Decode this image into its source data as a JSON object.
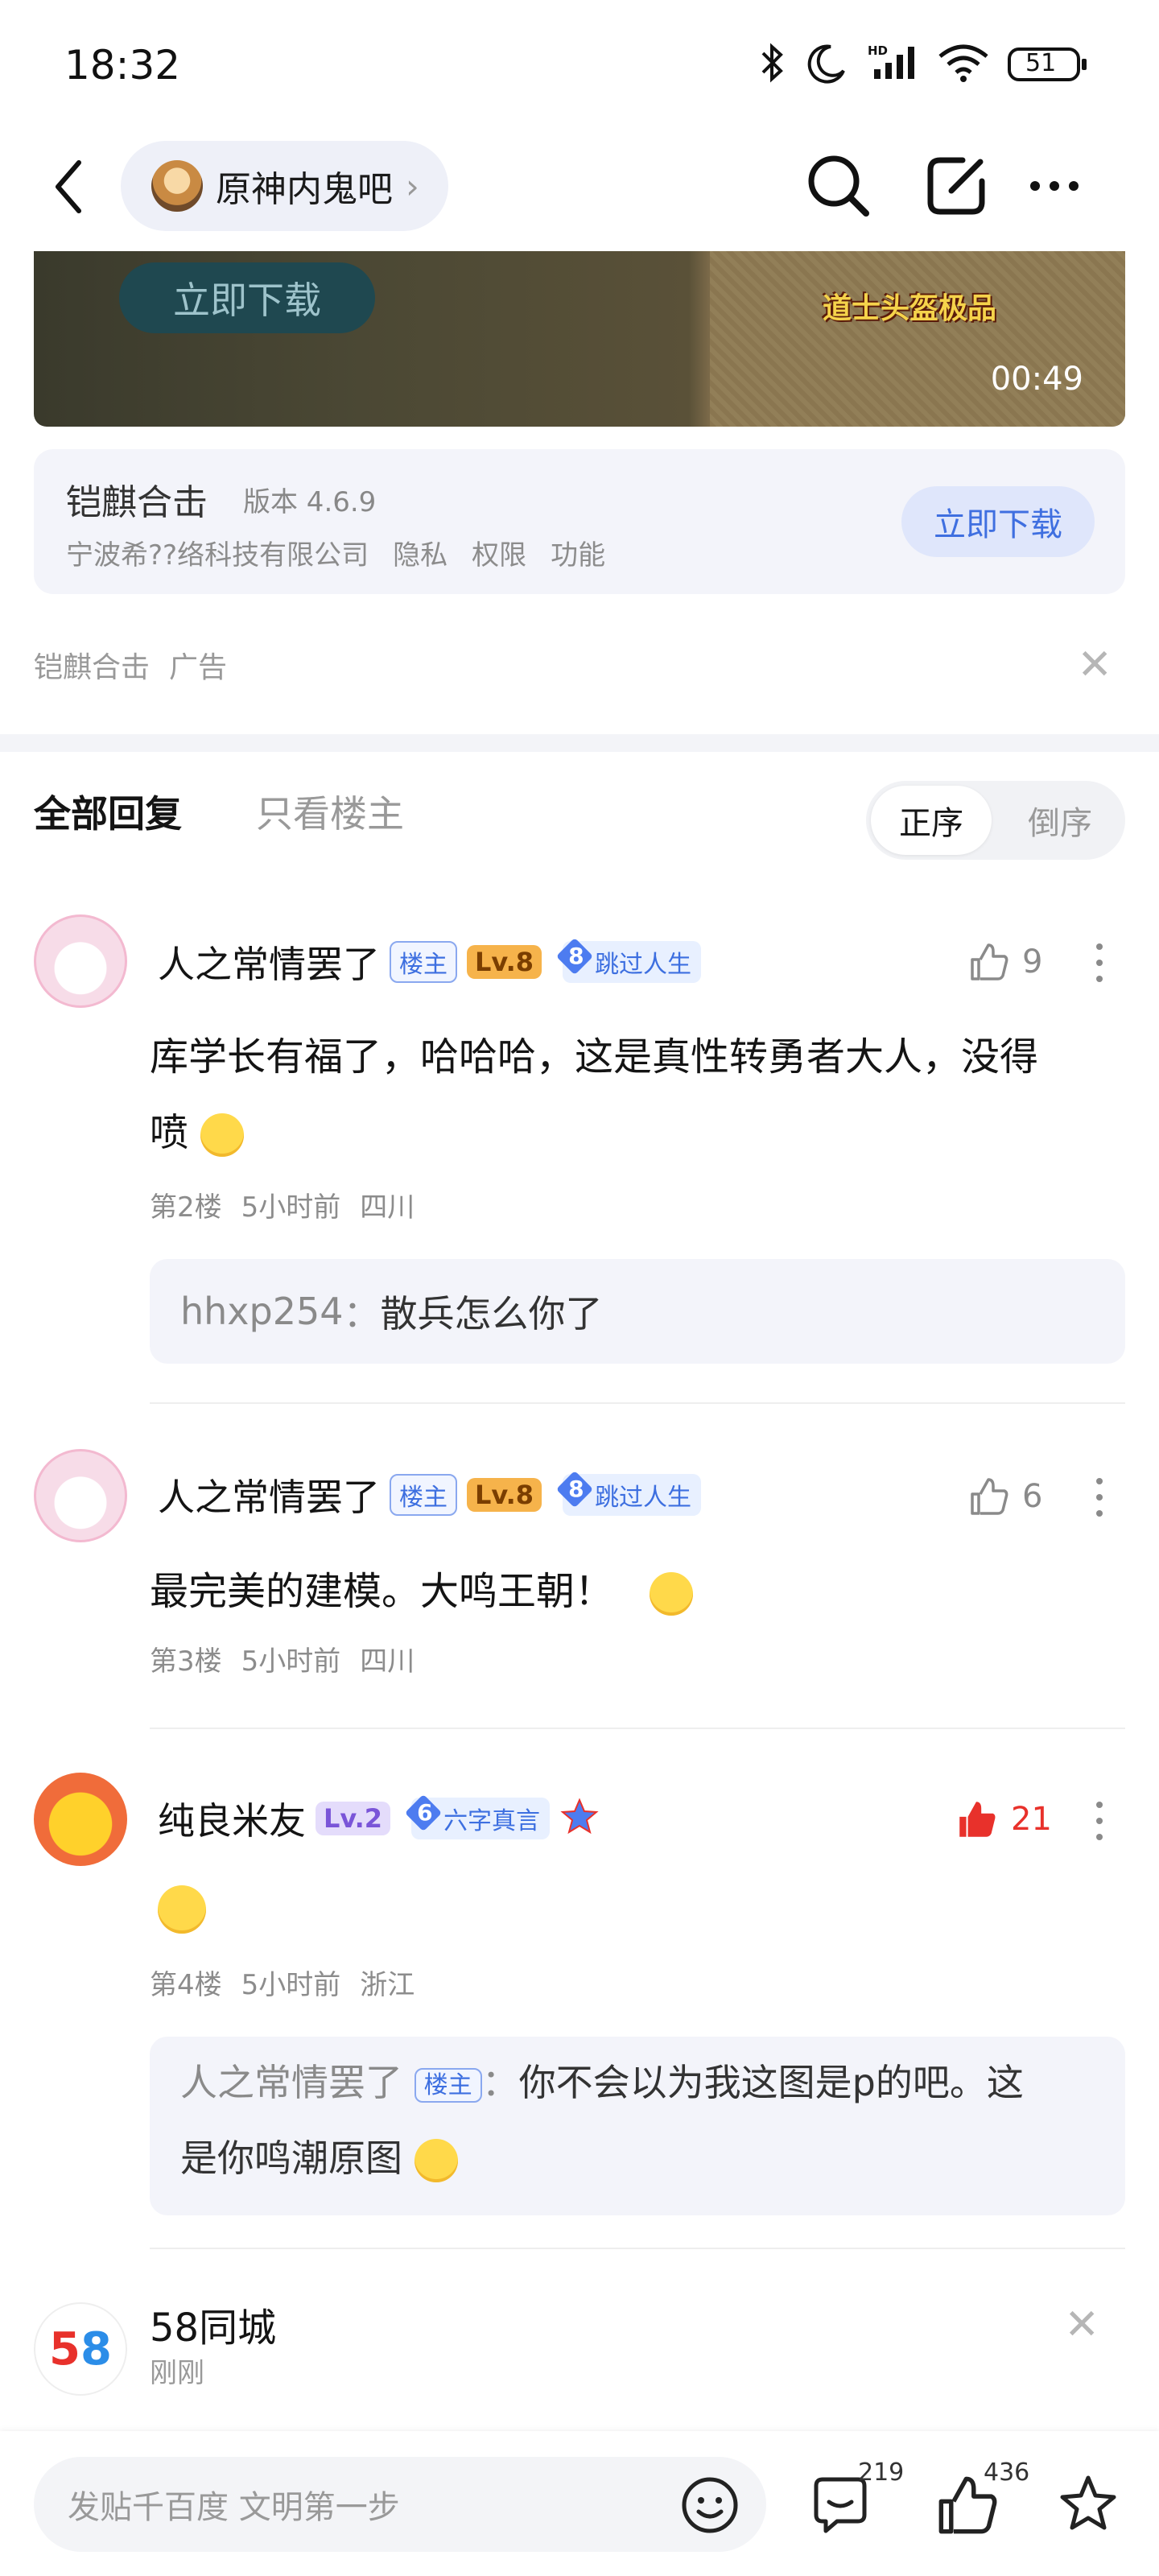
{
  "status_bar": {
    "time": "18:32",
    "battery": "51"
  },
  "nav": {
    "forum_name": "原神内鬼吧",
    "chevron": "›"
  },
  "ad": {
    "video_button": "立即下载",
    "video_caption": "道士头盔极品",
    "video_time": "00:49",
    "app_name": "铠麒合击",
    "version": "版本 4.6.9",
    "company": "宁波希??络科技有限公司",
    "links": [
      "隐私",
      "权限",
      "功能"
    ],
    "download": "立即下载",
    "source": "铠麒合击",
    "tag": "广告",
    "close": "✕"
  },
  "tabs": {
    "all": "全部回复",
    "op_only": "只看楼主"
  },
  "sort": {
    "asc": "正序",
    "desc": "倒序"
  },
  "posts": [
    {
      "username": "人之常情罢了",
      "op_badge": "楼主",
      "level": "Lv.8",
      "title_num": "8",
      "title": "跳过人生",
      "likes": "9",
      "content": "库学长有福了，哈哈哈，这是真性转勇者大人，没得",
      "content2": "喷",
      "floor": "第2楼",
      "time": "5小时前",
      "location": "四川",
      "reply_user": "hhxp254",
      "reply_sep": "：",
      "reply_text": "散兵怎么你了"
    },
    {
      "username": "人之常情罢了",
      "op_badge": "楼主",
      "level": "Lv.8",
      "title_num": "8",
      "title": "跳过人生",
      "likes": "6",
      "content": "最完美的建模。大鸣王朝！",
      "floor": "第3楼",
      "time": "5小时前",
      "location": "四川"
    },
    {
      "username": "纯良米友",
      "level": "Lv.2",
      "title_num": "6",
      "title": "六字真言",
      "likes": "21",
      "floor": "第4楼",
      "time": "5小时前",
      "location": "浙江",
      "reply_user": "人之常情罢了",
      "reply_badge": "楼主",
      "reply_sep": "：",
      "reply_text": "你不会以为我这图是p的吧。这",
      "reply_text2": "是你鸣潮原图"
    }
  ],
  "ad58": {
    "logo": "58",
    "name": "58同城",
    "time": "刚刚",
    "close": "✕"
  },
  "bottom": {
    "placeholder": "发贴千百度 文明第一步",
    "comments": "219",
    "likes": "436"
  },
  "colors": {
    "accent_blue": "#3d6fe0",
    "like_red": "#e8312b",
    "level_orange": "#f5a623",
    "level_purple": "#8e6be8"
  }
}
